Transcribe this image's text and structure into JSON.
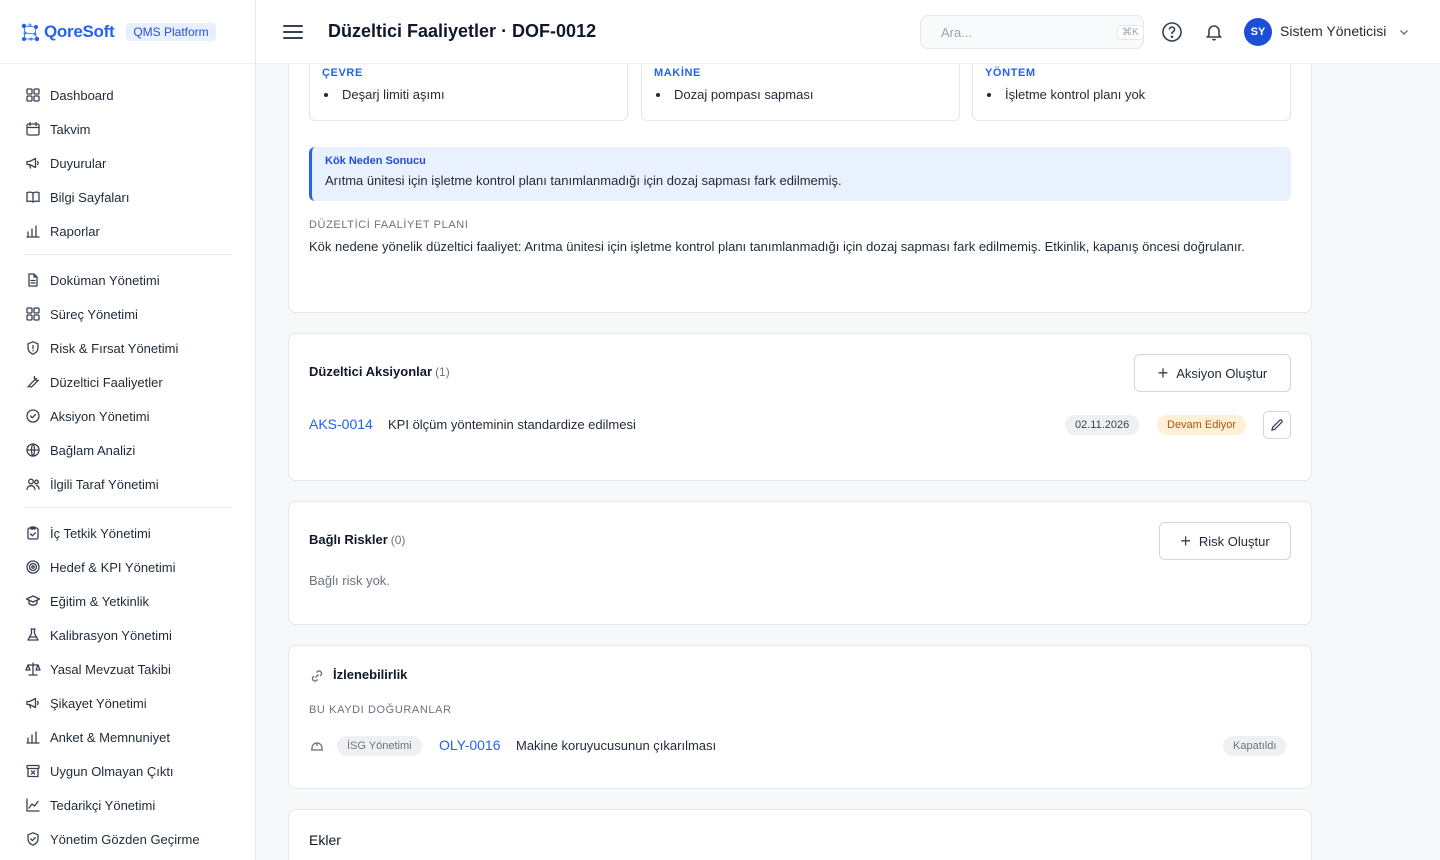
{
  "brand": {
    "name": "QoreSoft",
    "badge": "QMS Platform"
  },
  "header": {
    "title": "Düzeltici Faaliyetler · DOF-0012",
    "search_placeholder": "Ara...",
    "search_shortcut": "⌘K",
    "user_initials": "SY",
    "user_name": "Sistem Yöneticisi"
  },
  "sidebar": {
    "groups": [
      [
        {
          "label": "Dashboard",
          "icon": "dashboard-icon"
        },
        {
          "label": "Takvim",
          "icon": "calendar-icon"
        },
        {
          "label": "Duyurular",
          "icon": "megaphone-icon"
        },
        {
          "label": "Bilgi Sayfaları",
          "icon": "book-icon"
        },
        {
          "label": "Raporlar",
          "icon": "bar-chart-icon"
        }
      ],
      [
        {
          "label": "Doküman Yönetimi",
          "icon": "document-icon"
        },
        {
          "label": "Süreç Yönetimi",
          "icon": "grid-icon"
        },
        {
          "label": "Risk & Fırsat Yönetimi",
          "icon": "shield-icon"
        },
        {
          "label": "Düzeltici Faaliyetler",
          "icon": "wrench-icon"
        },
        {
          "label": "Aksiyon Yönetimi",
          "icon": "check-circle-icon"
        },
        {
          "label": "Bağlam Analizi",
          "icon": "globe-icon"
        },
        {
          "label": "İlgili Taraf Yönetimi",
          "icon": "users-icon"
        }
      ],
      [
        {
          "label": "İç Tetkik Yönetimi",
          "icon": "clipboard-check-icon"
        },
        {
          "label": "Hedef & KPI Yönetimi",
          "icon": "target-icon"
        },
        {
          "label": "Eğitim & Yetkinlik",
          "icon": "graduation-cap-icon"
        },
        {
          "label": "Kalibrasyon Yönetimi",
          "icon": "flask-icon"
        },
        {
          "label": "Yasal Mevzuat Takibi",
          "icon": "scale-icon"
        },
        {
          "label": "Şikayet Yönetimi",
          "icon": "megaphone-icon"
        },
        {
          "label": "Anket & Memnuniyet",
          "icon": "bar-chart-icon"
        },
        {
          "label": "Uygun Olmayan Çıktı",
          "icon": "archive-x-icon"
        },
        {
          "label": "Tedarikçi Yönetimi",
          "icon": "line-chart-icon"
        },
        {
          "label": "Yönetim Gözden Geçirme",
          "icon": "shield-check-icon"
        }
      ]
    ]
  },
  "fishbone": {
    "causes": [
      {
        "title": "ÇEVRE",
        "item": "Deşarj limiti aşımı"
      },
      {
        "title": "MAKİNE",
        "item": "Dozaj pompası sapması"
      },
      {
        "title": "YÖNTEM",
        "item": "İşletme kontrol planı yok"
      }
    ],
    "root_cause_title": "Kök Neden Sonucu",
    "root_cause_text": "Arıtma ünitesi için işletme kontrol planı tanımlanmadığı için dozaj sapması fark edilmemiş.",
    "plan_title": "DÜZELTİCİ FAALİYET PLANI",
    "plan_text": "Kök nedene yönelik düzeltici faaliyet: Arıtma ünitesi için işletme kontrol planı tanımlanmadığı için dozaj sapması fark edilmemiş. Etkinlik, kapanış öncesi doğrulanır."
  },
  "actions": {
    "title": "Düzeltici Aksiyonlar",
    "count": "(1)",
    "button": "Aksiyon Oluştur",
    "item": {
      "code": "AKS-0014",
      "title": "KPI ölçüm yönteminin standardize edilmesi",
      "date": "02.11.2026",
      "status": "Devam Ediyor"
    }
  },
  "risks": {
    "title": "Bağlı Riskler",
    "count": "(0)",
    "button": "Risk Oluştur",
    "empty": "Bağlı risk yok."
  },
  "traceability": {
    "title": "İzlenebilirlik",
    "subtitle": "BU KAYDI DOĞURANLAR",
    "item": {
      "module": "İSG Yönetimi",
      "code": "OLY-0016",
      "title": "Makine koruyucusunun çıkarılması",
      "status": "Kapatıldı"
    }
  },
  "attachments": {
    "title": "Ekler"
  }
}
